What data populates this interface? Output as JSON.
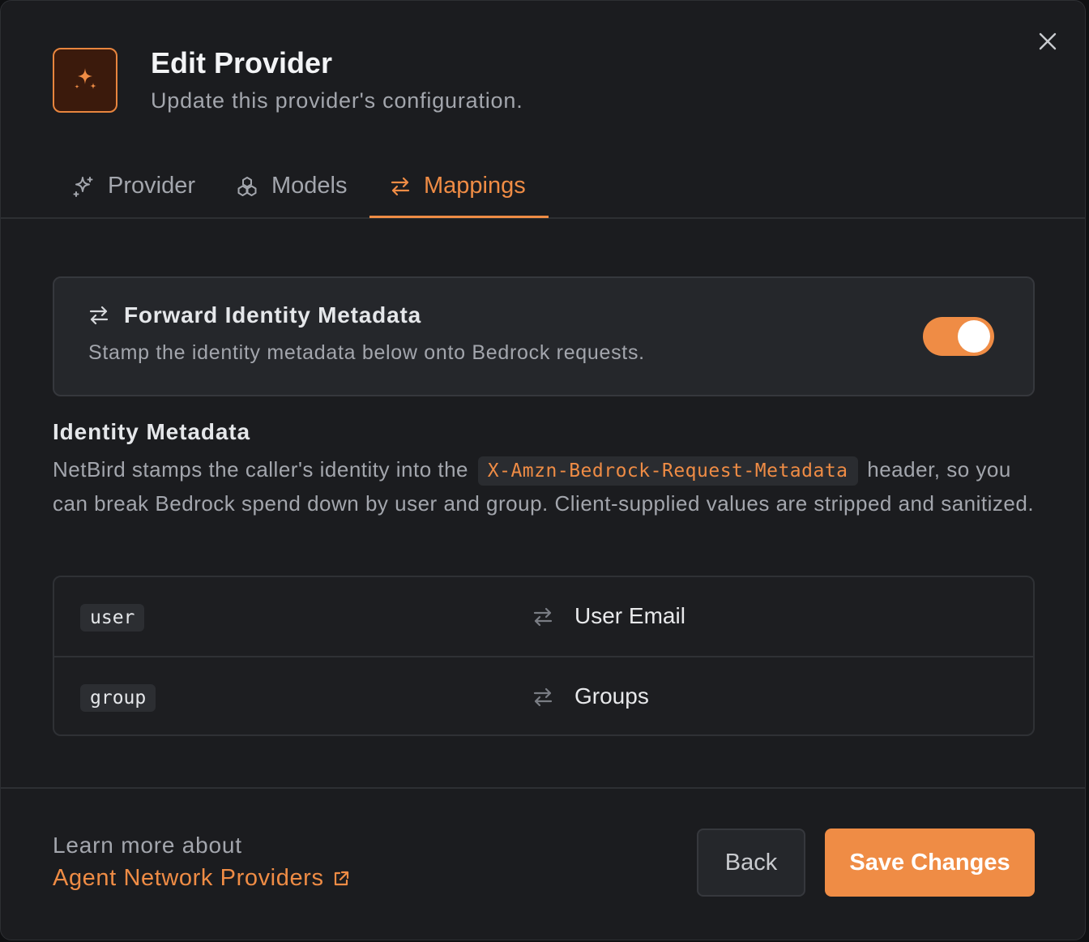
{
  "dialog": {
    "title": "Edit Provider",
    "subtitle": "Update this provider's configuration."
  },
  "tabs": [
    {
      "label": "Provider",
      "icon": "sparkles-icon",
      "active": false
    },
    {
      "label": "Models",
      "icon": "cubes-icon",
      "active": false
    },
    {
      "label": "Mappings",
      "icon": "arrows-swap-icon",
      "active": true
    }
  ],
  "forward_toggle": {
    "title": "Forward Identity Metadata",
    "description": "Stamp the identity metadata below onto Bedrock requests.",
    "enabled": true
  },
  "identity_metadata": {
    "title": "Identity Metadata",
    "desc_before": "NetBird stamps the caller's identity into the",
    "header_name": "X-Amzn-Bedrock-Request-Metadata",
    "desc_after": "header, so you can break Bedrock spend down by user and group. Client-supplied values are stripped and sanitized."
  },
  "mappings": [
    {
      "key": "user",
      "value": "User Email"
    },
    {
      "key": "group",
      "value": "Groups"
    }
  ],
  "footer": {
    "learn_more": "Learn more about",
    "link_label": "Agent Network Providers",
    "back_label": "Back",
    "save_label": "Save Changes"
  },
  "colors": {
    "accent": "#ef8c45",
    "background": "#1b1c1f",
    "card": "#25272b"
  }
}
